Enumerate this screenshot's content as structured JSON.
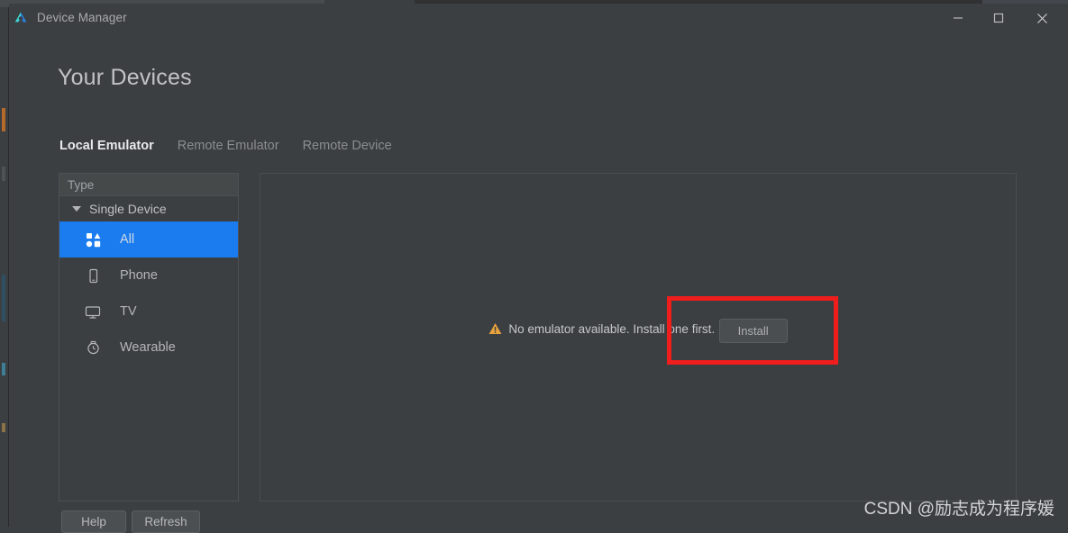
{
  "window": {
    "title": "Device Manager",
    "app_icon": "android-studio-icon",
    "controls": {
      "minimize": "minimize-icon",
      "maximize": "maximize-icon",
      "close": "close-icon"
    }
  },
  "page": {
    "title": "Your Devices"
  },
  "tabs": [
    {
      "label": "Local Emulator",
      "active": true
    },
    {
      "label": "Remote Emulator",
      "active": false
    },
    {
      "label": "Remote Device",
      "active": false
    }
  ],
  "sidebar": {
    "header": "Type",
    "group": {
      "label": "Single Device",
      "expanded": true
    },
    "items": [
      {
        "label": "All",
        "icon": "grid-shapes-icon",
        "selected": true
      },
      {
        "label": "Phone",
        "icon": "phone-icon",
        "selected": false
      },
      {
        "label": "TV",
        "icon": "tv-icon",
        "selected": false
      },
      {
        "label": "Wearable",
        "icon": "watch-icon",
        "selected": false
      }
    ]
  },
  "main": {
    "empty_state": {
      "icon": "warning-triangle-icon",
      "message": "No emulator available. Install one first.",
      "install_label": "Install",
      "highlight_color": "#f01d1d"
    }
  },
  "footer": {
    "help_label": "Help",
    "refresh_label": "Refresh"
  },
  "watermark": {
    "text": "CSDN @励志成为程序媛"
  },
  "colors": {
    "window_background": "#3c3f41",
    "panel_border": "#4c5052",
    "selection_blue": "#1a7cef",
    "warning_amber": "#e8a33d",
    "text_primary": "#c2c3c4",
    "text_secondary": "#8a8d8f"
  }
}
